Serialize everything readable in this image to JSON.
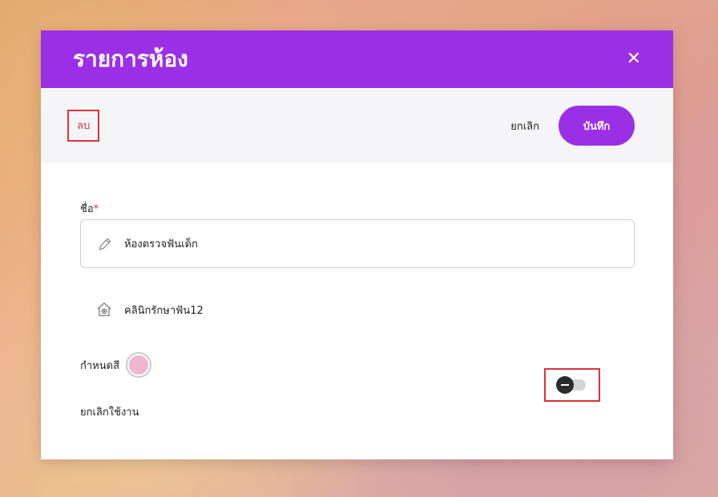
{
  "modal": {
    "title": "รายการห้อง",
    "close_symbol": "✕"
  },
  "actions": {
    "delete_label": "ลบ",
    "cancel_label": "ยกเลิก",
    "save_label": "บันทึก"
  },
  "form": {
    "name_label": "ชื่อ",
    "required_mark": "*",
    "name_value": "ห้องตรวจฟันเด็ก",
    "clinic_name": "คลินิกรักษาฟัน12",
    "color_label": "กำหนดสี",
    "selected_color": "#f1b5cf",
    "disable_label": "ยกเลิกใช้งาน",
    "disable_toggle_on": false
  },
  "colors": {
    "accent": "#9b2fe6",
    "danger": "#e1303a"
  },
  "icons": {
    "name_field": "pencil-icon",
    "clinic": "clinic-home-icon",
    "close": "close-icon"
  }
}
